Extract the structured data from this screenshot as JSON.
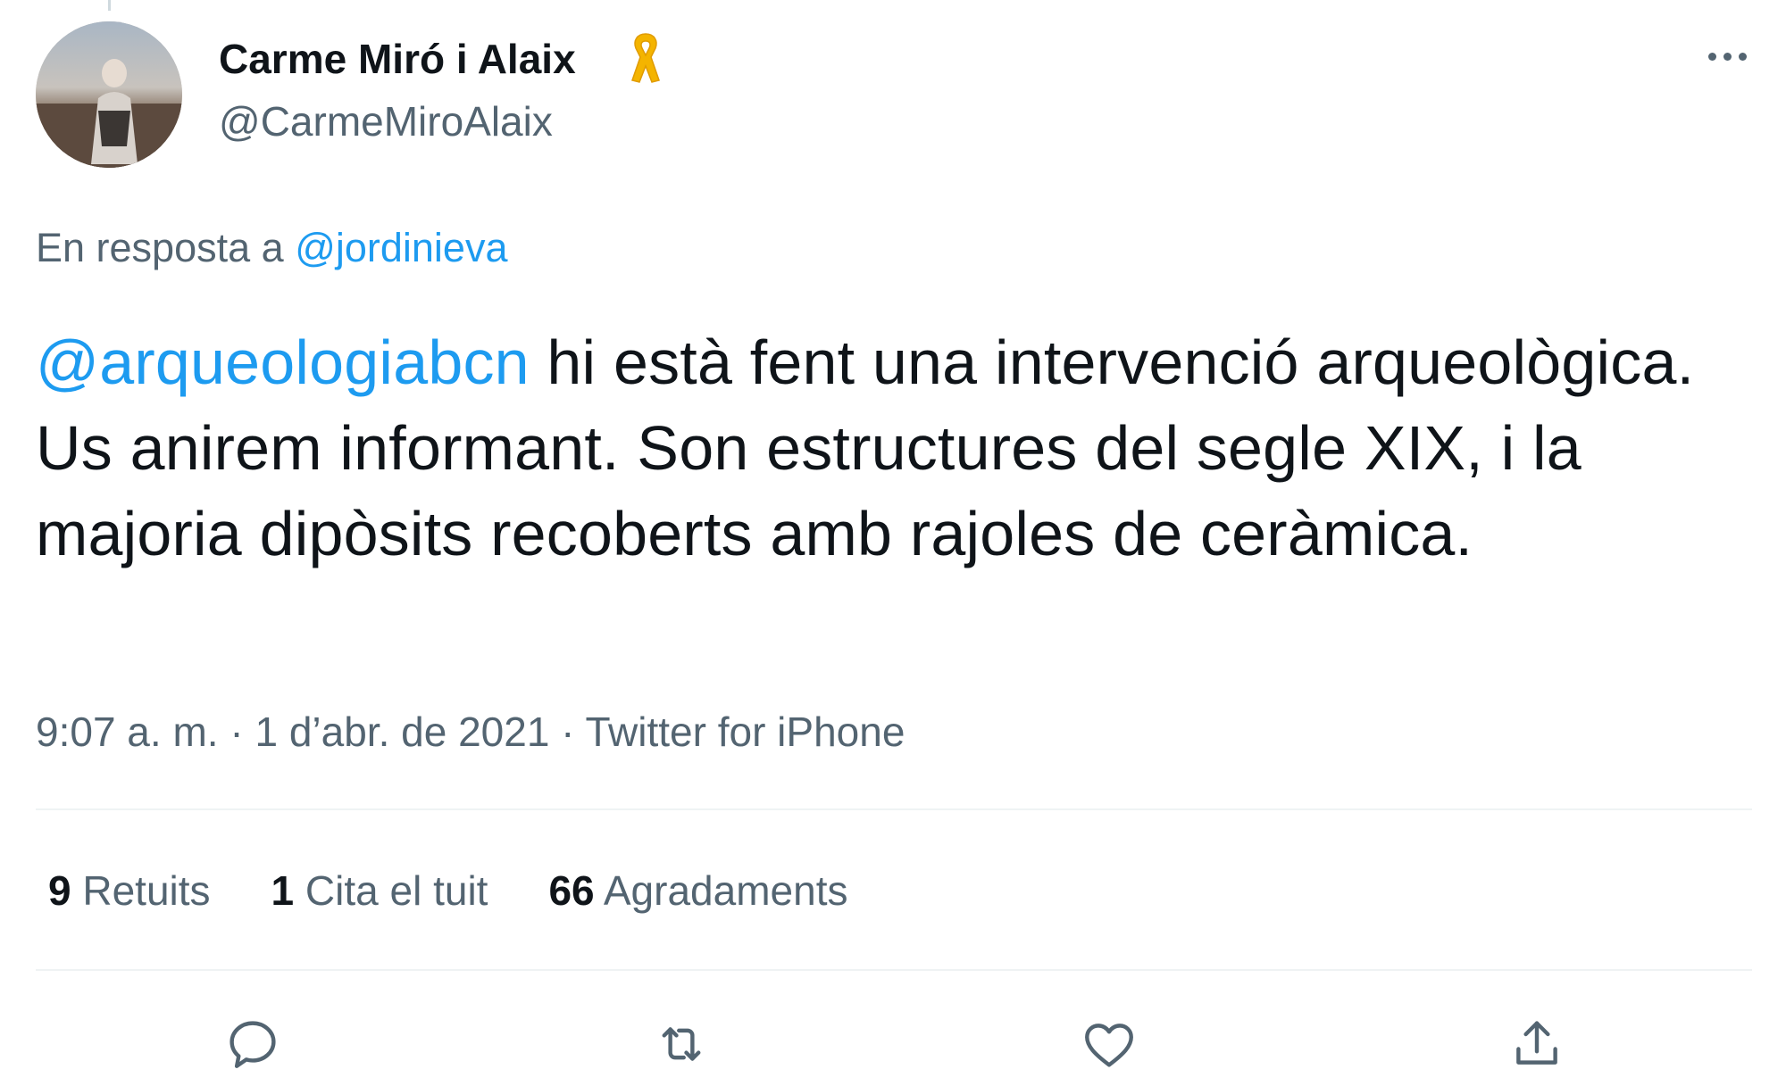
{
  "author": {
    "name": "Carme Miró i Alaix",
    "handle": "@CarmeMiroAlaix",
    "badge_icon": "yellow-ribbon-icon",
    "badge_color": "#f4b400"
  },
  "reply_to": {
    "prefix": "En resposta a",
    "mention": "@jordinieva"
  },
  "tweet": {
    "mention": "@arqueologiabcn",
    "text": " hi està fent una intervenció arqueològica. Us anirem informant. Son estructures del segle XIX, i la majoria dipòsits recoberts amb rajoles de ceràmica."
  },
  "meta": {
    "time": "9:07 a. m.",
    "separator": " · ",
    "date": "1 d’abr. de 2021",
    "source": "Twitter for iPhone"
  },
  "stats": [
    {
      "count": "9",
      "label": "Retuits"
    },
    {
      "count": "1",
      "label": "Cita el tuit"
    },
    {
      "count": "66",
      "label": "Agradaments"
    }
  ],
  "actions": [
    {
      "icon": "reply-icon"
    },
    {
      "icon": "retweet-icon"
    },
    {
      "icon": "heart-icon"
    },
    {
      "icon": "share-icon"
    }
  ],
  "colors": {
    "link": "#1d9bf0",
    "secondary_text": "#536471",
    "primary_text": "#0f1419",
    "divider": "#eff3f4"
  }
}
